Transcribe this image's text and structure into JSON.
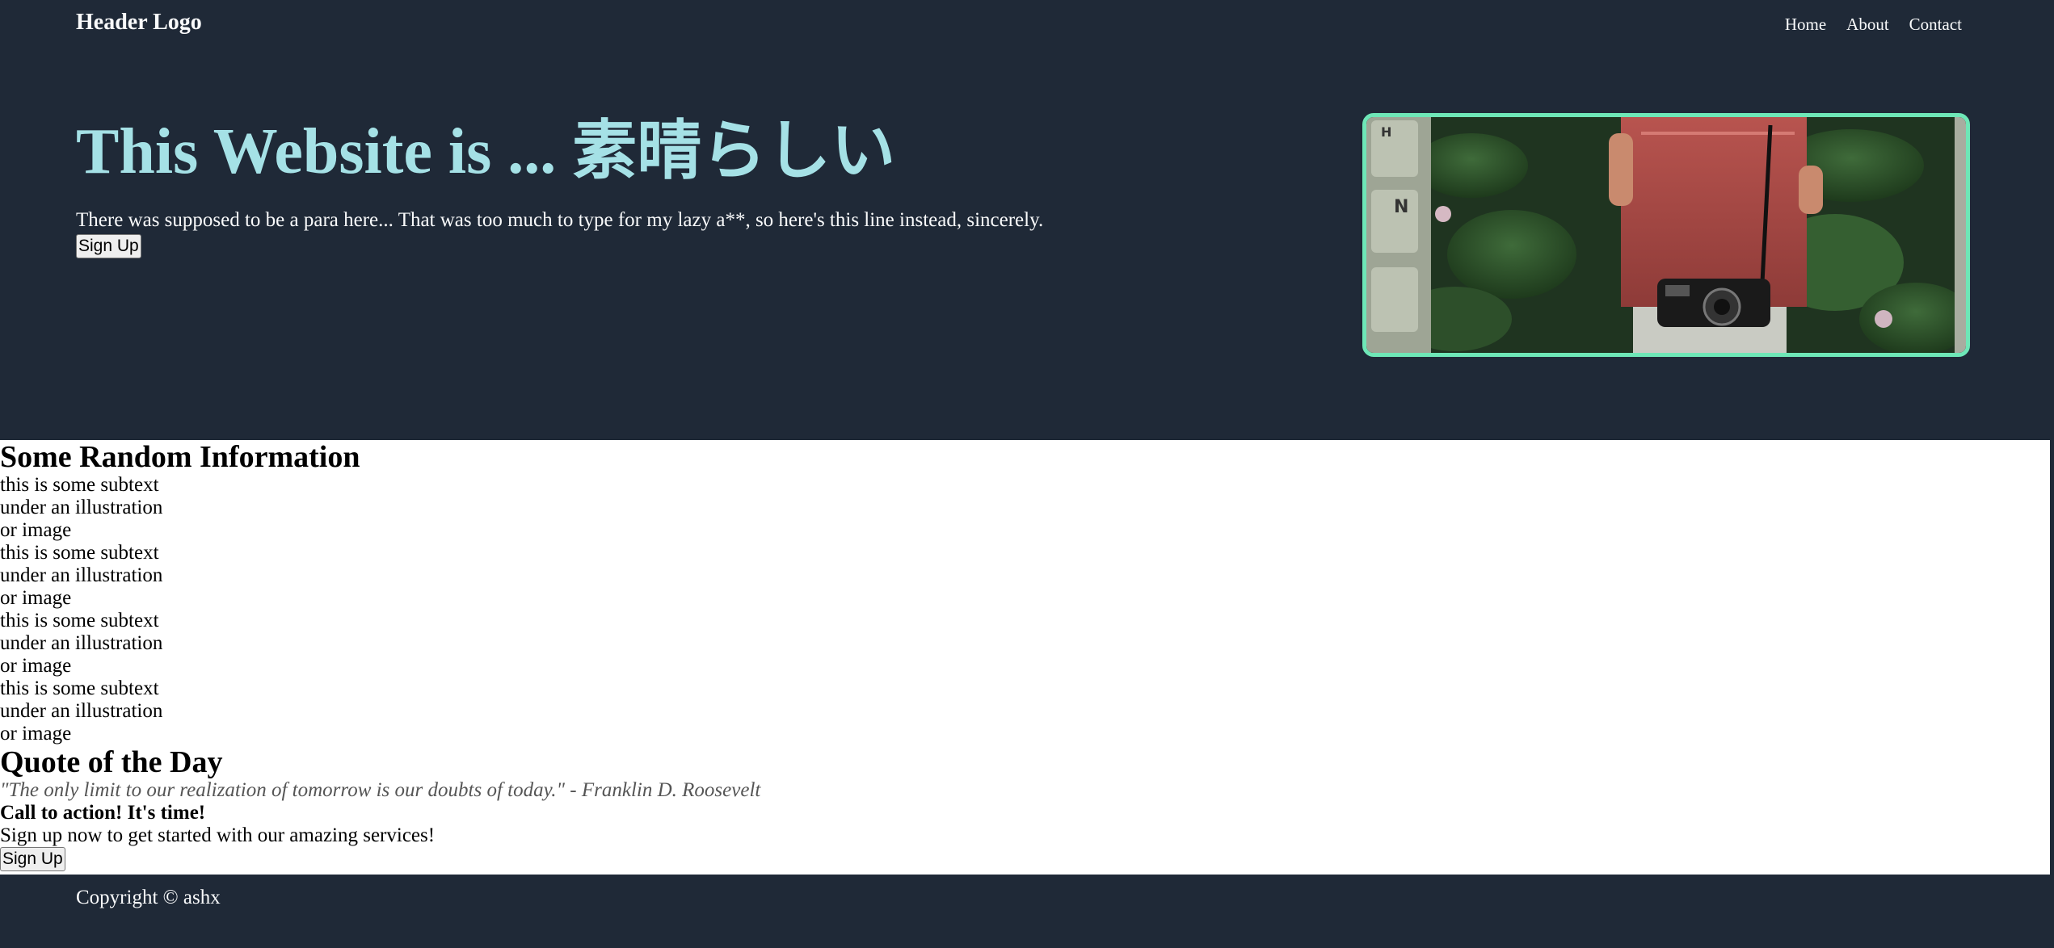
{
  "header": {
    "logo": "Header Logo",
    "nav": [
      "Home",
      "About",
      "Contact"
    ]
  },
  "hero": {
    "title": "This Website is ... 素晴らしい",
    "text": "There was supposed to be a para here... That was too much to type for my lazy a**, so here's this line instead, sincerely.",
    "button": "Sign Up"
  },
  "info": {
    "heading": "Some Random Information",
    "items": [
      [
        "this is some subtext",
        "under an illustration",
        "or image"
      ],
      [
        "this is some subtext",
        "under an illustration",
        "or image"
      ],
      [
        "this is some subtext",
        "under an illustration",
        "or image"
      ],
      [
        "this is some subtext",
        "under an illustration",
        "or image"
      ]
    ]
  },
  "quote": {
    "heading": "Quote of the Day",
    "text": "\"The only limit to our realization of tomorrow is our doubts of today.\" - Franklin D. Roosevelt"
  },
  "cta": {
    "title": "Call to action! It's time!",
    "text": "Sign up now to get started with our amazing services!",
    "button": "Sign Up"
  },
  "footer": {
    "copyright": "Copyright © ashx"
  },
  "colors": {
    "background": "#1f2937",
    "accent": "#a5e1e6",
    "image_border": "#6ee7b7"
  }
}
